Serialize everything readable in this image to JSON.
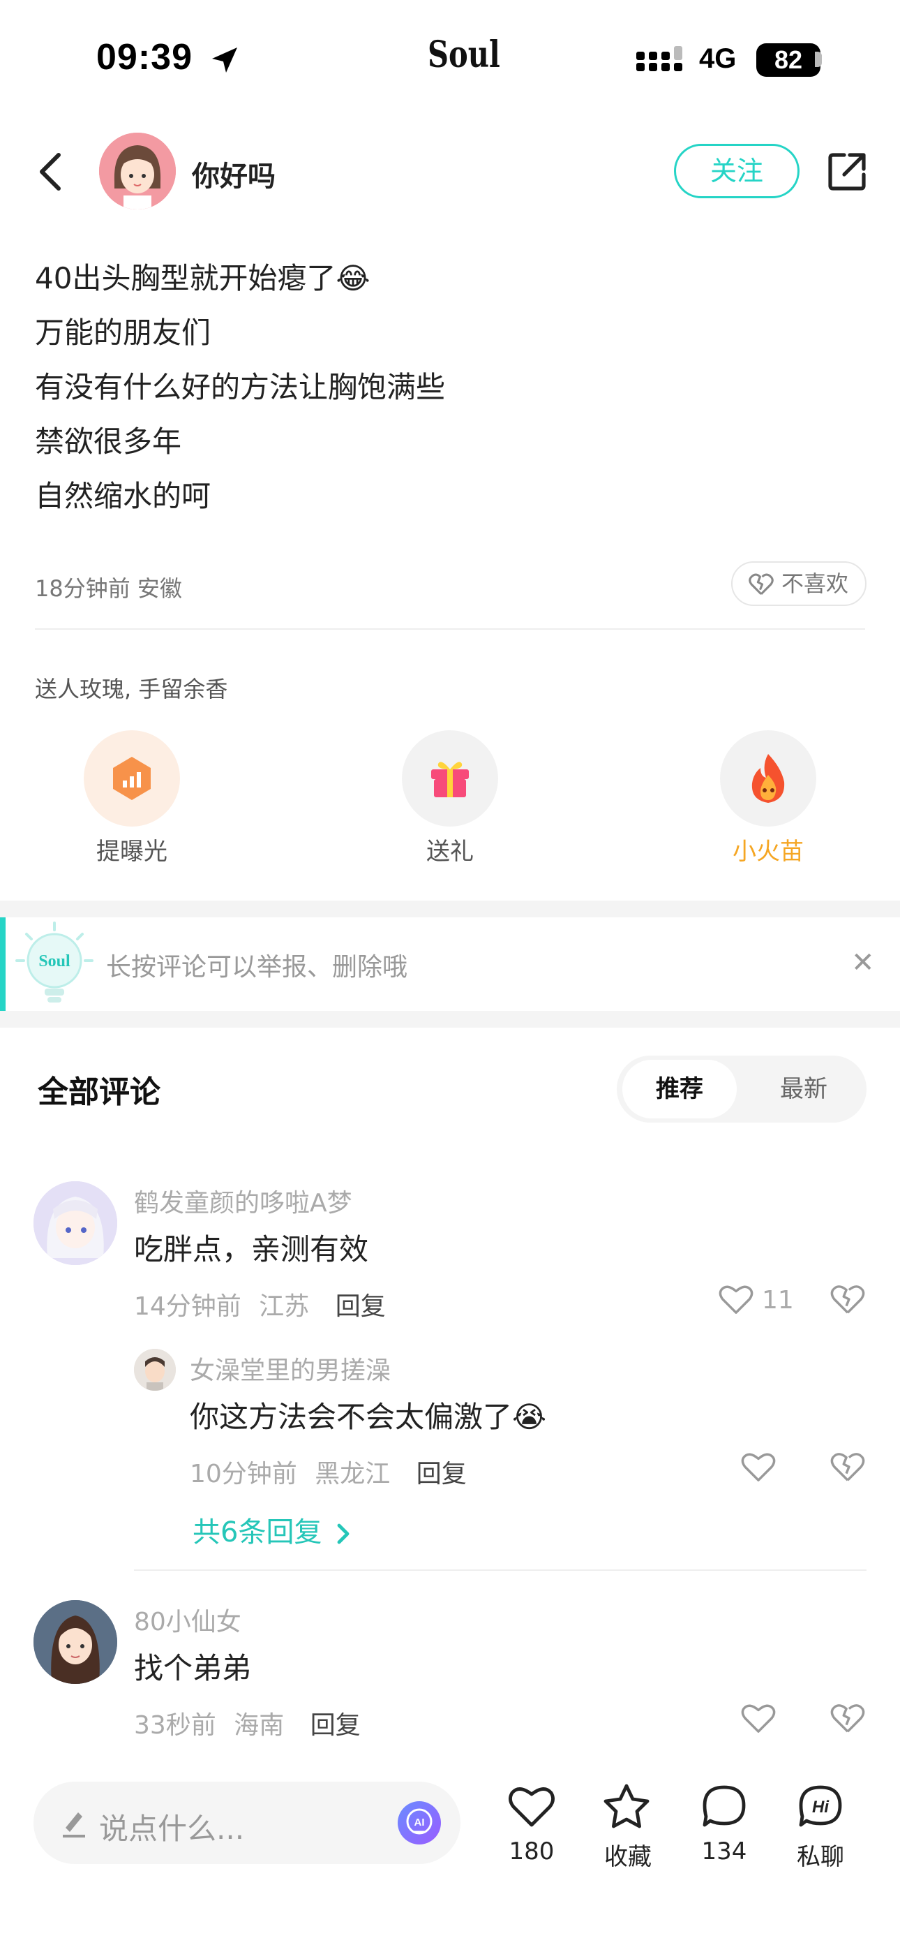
{
  "status_bar": {
    "time": "09:39",
    "app_logo": "Soul",
    "network": "4G",
    "battery": "82"
  },
  "header": {
    "username": "你好吗",
    "follow_label": "关注"
  },
  "post": {
    "lines": [
      "40出头胸型就开始瘪了😂",
      "万能的朋友们",
      "有没有什么好的方法让胸饱满些",
      "禁欲很多年",
      "自然缩水的呵"
    ],
    "time_location": "18分钟前 安徽",
    "dislike_label": "不喜欢"
  },
  "gifts": {
    "title": "送人玫瑰, 手留余香",
    "actions": [
      {
        "label": "提曝光",
        "icon": "boost-icon"
      },
      {
        "label": "送礼",
        "icon": "gift-icon"
      },
      {
        "label": "小火苗",
        "icon": "flame-icon"
      }
    ]
  },
  "tip": {
    "logo": "Soul",
    "text": "长按评论可以举报、删除哦"
  },
  "comments_section": {
    "title": "全部评论",
    "sort_options": [
      "推荐",
      "最新"
    ],
    "active_sort": "推荐"
  },
  "comments": [
    {
      "name": "鹤发童颜的哆啦A梦",
      "text": "吃胖点，亲测有效",
      "time": "14分钟前",
      "location": "江苏",
      "reply_label": "回复",
      "likes": "11",
      "replies": [
        {
          "name": "女澡堂里的男搓澡",
          "text": "你这方法会不会太偏激了😭",
          "time": "10分钟前",
          "location": "黑龙江",
          "reply_label": "回复"
        }
      ],
      "more_replies": "共6条回复"
    },
    {
      "name": "80小仙女",
      "text": "找个弟弟",
      "time": "33秒前",
      "location": "海南",
      "reply_label": "回复"
    }
  ],
  "bottom_bar": {
    "input_placeholder": "说点什么...",
    "like_count": "180",
    "favorite_label": "收藏",
    "comment_count": "134",
    "chat_label": "私聊"
  },
  "colors": {
    "accent": "#25d4c6",
    "flame": "#f5a623"
  }
}
